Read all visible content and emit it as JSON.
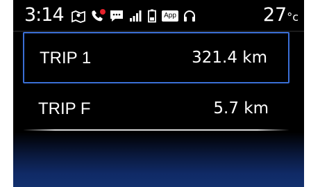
{
  "status_bar": {
    "time": "3:14",
    "temperature": "27",
    "temperature_unit": "°c",
    "icons": [
      "navigation-map-icon",
      "missed-call-icon",
      "message-icon",
      "signal-strength-icon",
      "battery-icon",
      "app-icon",
      "headset-icon"
    ],
    "app_label": "App",
    "missed_call_badge_color": "#e8202a"
  },
  "trips": [
    {
      "label": "TRIP 1",
      "value": "321.4 km",
      "selected": true
    },
    {
      "label": "TRIP F",
      "value": "5.7 km",
      "selected": false
    }
  ],
  "colors": {
    "selection_border": "#3b6fd6",
    "background": "#000000",
    "bottom_glow": "#12306e"
  }
}
